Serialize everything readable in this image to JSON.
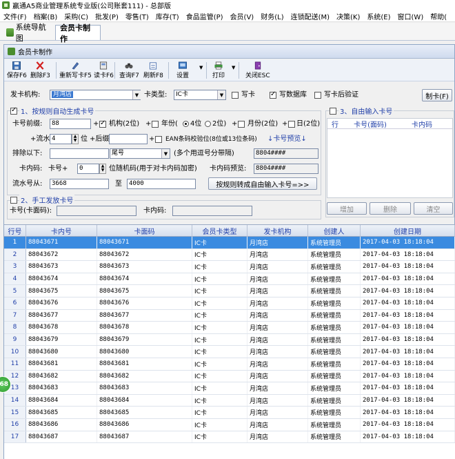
{
  "app": {
    "title": "赢通A5商业管理系统专业版(公司账套111) - 总部版"
  },
  "menu": [
    "文件(F)",
    "档案(B)",
    "采购(C)",
    "批发(P)",
    "零售(T)",
    "库存(T)",
    "食品监管(P)",
    "会员(V)",
    "财务(L)",
    "连锁配送(M)",
    "决策(K)",
    "系统(E)",
    "窗口(W)",
    "帮助("
  ],
  "tabs": {
    "nav": "系统导航图",
    "active": "会员卡制作"
  },
  "window": {
    "title": "会员卡制作"
  },
  "toolbar": {
    "save": "保存F6",
    "delete": "删除F3",
    "rewrite": "重新写卡F5",
    "read": "读卡F6",
    "query": "查询F7",
    "refresh": "刷新F8",
    "settings": "设置",
    "print": "打印",
    "close": "关闭ESC"
  },
  "form": {
    "issuer_label": "发卡机构:",
    "issuer_value": "月湾店",
    "cardtype_label": "卡类型:",
    "cardtype_value": "IC卡",
    "write_card": "写卡",
    "write_db": "写数据库",
    "verify_after": "写卡后验证",
    "make_card_btn": "制卡(F)",
    "section1": "1、按规则自动生成卡号",
    "prefix_label": "卡号前缀:",
    "prefix_value": "88",
    "plus": "+",
    "org_opt": "机构(2位)",
    "year_opt": "年份(",
    "year_4": "4位",
    "year_2": "2位)",
    "month_opt": "月份(2位)",
    "day_opt": "日(2位)",
    "serial_label": "+流水号",
    "serial_value": "4",
    "serial_unit": "位",
    "suffix_label": "+后缀",
    "ean_label": "EAN条码校验位(8位或13位条码)",
    "preview_link": "↓卡号预览↓",
    "exclude_label": "排除以下:",
    "tail_value": "尾号",
    "multi_hint": "(多个用逗号分带隔)",
    "preview1": "8804####",
    "pin_label": "卡内码:",
    "pin_cardno": "卡号+",
    "pin_value": "0",
    "pin_hint": "位随机码(用于对卡内码加密)",
    "pin_preview_label": "卡内码预览:",
    "pin_preview": "8804####",
    "serial_from_label": "流水号从:",
    "serial_from": "3668",
    "to_label": "至",
    "serial_to": "4000",
    "convert_btn": "按规则转成自由输入卡号=>>",
    "section2": "2、手工发放卡号",
    "manual_card_label": "卡号(卡面码):",
    "manual_pin_label": "卡内码:",
    "section3": "3、自由输入卡号",
    "free_cols": [
      "行",
      "卡号(面码)",
      "卡内码"
    ],
    "add_btn": "增加",
    "del_btn": "删除",
    "clear_btn": "清空"
  },
  "grid": {
    "columns": [
      "行号",
      "卡内号",
      "卡面码",
      "会员卡类型",
      "发卡机构",
      "创建人",
      "创建日期"
    ],
    "rows": [
      [
        "1",
        "88043671",
        "88043671",
        "IC卡",
        "月湾店",
        "系统管理员",
        "2017-04-03 18:18:04"
      ],
      [
        "2",
        "88043672",
        "88043672",
        "IC卡",
        "月湾店",
        "系统管理员",
        "2017-04-03 18:18:04"
      ],
      [
        "3",
        "88043673",
        "88043673",
        "IC卡",
        "月湾店",
        "系统管理员",
        "2017-04-03 18:18:04"
      ],
      [
        "4",
        "88043674",
        "88043674",
        "IC卡",
        "月湾店",
        "系统管理员",
        "2017-04-03 18:18:04"
      ],
      [
        "5",
        "88043675",
        "88043675",
        "IC卡",
        "月湾店",
        "系统管理员",
        "2017-04-03 18:18:04"
      ],
      [
        "6",
        "88043676",
        "88043676",
        "IC卡",
        "月湾店",
        "系统管理员",
        "2017-04-03 18:18:04"
      ],
      [
        "7",
        "88043677",
        "88043677",
        "IC卡",
        "月湾店",
        "系统管理员",
        "2017-04-03 18:18:04"
      ],
      [
        "8",
        "88043678",
        "88043678",
        "IC卡",
        "月湾店",
        "系统管理员",
        "2017-04-03 18:18:04"
      ],
      [
        "9",
        "88043679",
        "88043679",
        "IC卡",
        "月湾店",
        "系统管理员",
        "2017-04-03 18:18:04"
      ],
      [
        "10",
        "88043680",
        "88043680",
        "IC卡",
        "月湾店",
        "系统管理员",
        "2017-04-03 18:18:04"
      ],
      [
        "11",
        "88043681",
        "88043681",
        "IC卡",
        "月湾店",
        "系统管理员",
        "2017-04-03 18:18:04"
      ],
      [
        "12",
        "88043682",
        "88043682",
        "IC卡",
        "月湾店",
        "系统管理员",
        "2017-04-03 18:18:04"
      ],
      [
        "13",
        "88043683",
        "88043683",
        "IC卡",
        "月湾店",
        "系统管理员",
        "2017-04-03 18:18:04"
      ],
      [
        "14",
        "88043684",
        "88043684",
        "IC卡",
        "月湾店",
        "系统管理员",
        "2017-04-03 18:18:04"
      ],
      [
        "15",
        "88043685",
        "88043685",
        "IC卡",
        "月湾店",
        "系统管理员",
        "2017-04-03 18:18:04"
      ],
      [
        "16",
        "88043686",
        "88043686",
        "IC卡",
        "月湾店",
        "系统管理员",
        "2017-04-03 18:18:04"
      ],
      [
        "17",
        "88043687",
        "88043687",
        "IC卡",
        "月湾店",
        "系统管理员",
        "2017-04-03 18:18:04"
      ]
    ]
  },
  "badge": "68",
  "colors": {
    "selection": "#3a8be0",
    "header_text": "#1f3ea8"
  }
}
